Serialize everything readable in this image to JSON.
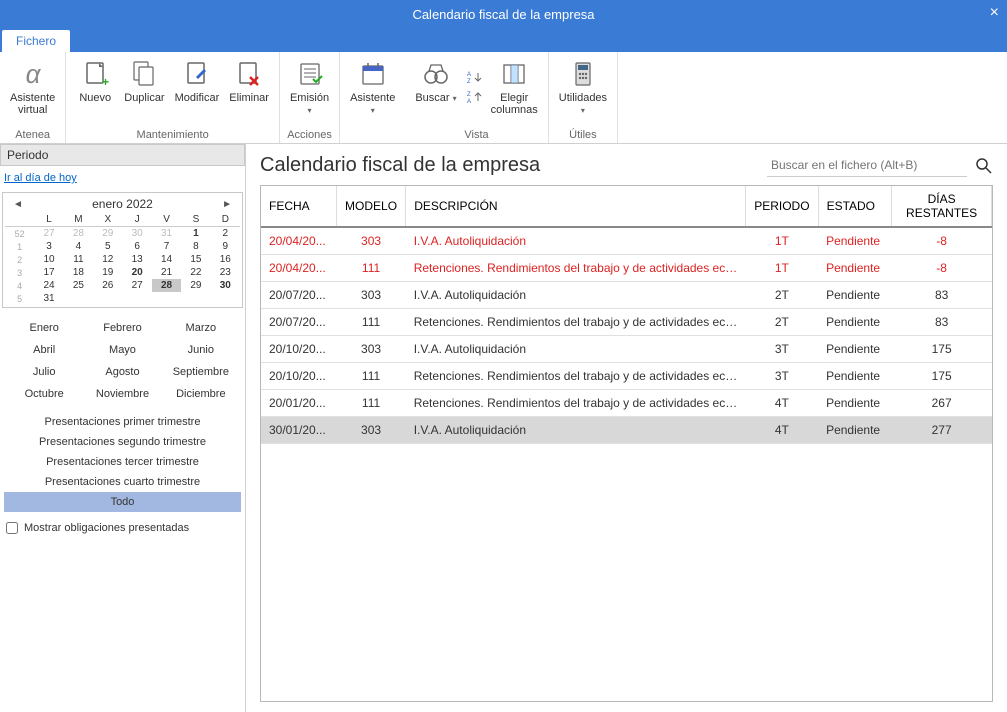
{
  "window": {
    "title": "Calendario fiscal de la empresa"
  },
  "tabs": {
    "file": "Fichero"
  },
  "ribbon": {
    "atenea": {
      "line1": "Asistente",
      "line2": "virtual",
      "group": "Atenea"
    },
    "maint": {
      "nuevo": "Nuevo",
      "duplicar": "Duplicar",
      "modificar": "Modificar",
      "eliminar": "Eliminar",
      "group": "Mantenimiento"
    },
    "acciones": {
      "emision": "Emisión",
      "group": "Acciones"
    },
    "asistente": {
      "label": "Asistente"
    },
    "vista": {
      "buscar": "Buscar",
      "cols1": "Elegir",
      "cols2": "columnas",
      "group": "Vista"
    },
    "utiles": {
      "label": "Utilidades",
      "group": "Útiles"
    }
  },
  "sidebar": {
    "period_title": "Periodo",
    "today_link": "Ir al día de hoy",
    "cal_title": "enero  2022",
    "dow": [
      "L",
      "M",
      "X",
      "J",
      "V",
      "S",
      "D"
    ],
    "weeks": [
      {
        "wk": "52",
        "days": [
          [
            "27",
            true
          ],
          [
            "28",
            true
          ],
          [
            "29",
            true
          ],
          [
            "30",
            true
          ],
          [
            "31",
            true
          ],
          [
            "1",
            false,
            "bold"
          ],
          [
            "2",
            false
          ]
        ]
      },
      {
        "wk": "1",
        "days": [
          [
            "3",
            false
          ],
          [
            "4",
            false
          ],
          [
            "5",
            false
          ],
          [
            "6",
            false
          ],
          [
            "7",
            false
          ],
          [
            "8",
            false
          ],
          [
            "9",
            false
          ]
        ]
      },
      {
        "wk": "2",
        "days": [
          [
            "10",
            false
          ],
          [
            "11",
            false
          ],
          [
            "12",
            false
          ],
          [
            "13",
            false
          ],
          [
            "14",
            false
          ],
          [
            "15",
            false
          ],
          [
            "16",
            false
          ]
        ]
      },
      {
        "wk": "3",
        "days": [
          [
            "17",
            false
          ],
          [
            "18",
            false
          ],
          [
            "19",
            false
          ],
          [
            "20",
            false,
            "bold"
          ],
          [
            "21",
            false
          ],
          [
            "22",
            false
          ],
          [
            "23",
            false
          ]
        ]
      },
      {
        "wk": "4",
        "days": [
          [
            "24",
            false
          ],
          [
            "25",
            false
          ],
          [
            "26",
            false
          ],
          [
            "27",
            false
          ],
          [
            "28",
            false,
            "today"
          ],
          [
            "29",
            false
          ],
          [
            "30",
            false,
            "bold"
          ]
        ]
      },
      {
        "wk": "5",
        "days": [
          [
            "31",
            false
          ],
          [
            "",
            false
          ],
          [
            "",
            false
          ],
          [
            "",
            false
          ],
          [
            "",
            false
          ],
          [
            "",
            false
          ],
          [
            "",
            false
          ]
        ]
      }
    ],
    "months": [
      "Enero",
      "Febrero",
      "Marzo",
      "Abril",
      "Mayo",
      "Junio",
      "Julio",
      "Agosto",
      "Septiembre",
      "Octubre",
      "Noviembre",
      "Diciembre"
    ],
    "presentations": [
      "Presentaciones primer trimestre",
      "Presentaciones segundo trimestre",
      "Presentaciones tercer trimestre",
      "Presentaciones cuarto trimestre"
    ],
    "todo": "Todo",
    "show_presented": "Mostrar obligaciones presentadas"
  },
  "main": {
    "title": "Calendario fiscal de la empresa",
    "search_placeholder": "Buscar en el fichero (Alt+B)",
    "columns": {
      "fecha": "FECHA",
      "modelo": "MODELO",
      "desc": "DESCRIPCIÓN",
      "periodo": "PERIODO",
      "estado": "ESTADO",
      "dias": "DÍAS RESTANTES"
    },
    "rows": [
      {
        "fecha": "20/04/20...",
        "modelo": "303",
        "desc": "I.V.A. Autoliquidación",
        "periodo": "1T",
        "estado": "Pendiente",
        "dias": "-8",
        "overdue": true
      },
      {
        "fecha": "20/04/20...",
        "modelo": "111",
        "desc": "Retenciones. Rendimientos del trabajo y de actividades econó...",
        "periodo": "1T",
        "estado": "Pendiente",
        "dias": "-8",
        "overdue": true
      },
      {
        "fecha": "20/07/20...",
        "modelo": "303",
        "desc": "I.V.A. Autoliquidación",
        "periodo": "2T",
        "estado": "Pendiente",
        "dias": "83"
      },
      {
        "fecha": "20/07/20...",
        "modelo": "111",
        "desc": "Retenciones. Rendimientos del trabajo y de actividades econó...",
        "periodo": "2T",
        "estado": "Pendiente",
        "dias": "83"
      },
      {
        "fecha": "20/10/20...",
        "modelo": "303",
        "desc": "I.V.A. Autoliquidación",
        "periodo": "3T",
        "estado": "Pendiente",
        "dias": "175"
      },
      {
        "fecha": "20/10/20...",
        "modelo": "111",
        "desc": "Retenciones. Rendimientos del trabajo y de actividades econó...",
        "periodo": "3T",
        "estado": "Pendiente",
        "dias": "175"
      },
      {
        "fecha": "20/01/20...",
        "modelo": "111",
        "desc": "Retenciones. Rendimientos del trabajo y de actividades econó...",
        "periodo": "4T",
        "estado": "Pendiente",
        "dias": "267"
      },
      {
        "fecha": "30/01/20...",
        "modelo": "303",
        "desc": "I.V.A. Autoliquidación",
        "periodo": "4T",
        "estado": "Pendiente",
        "dias": "277",
        "selected": true
      }
    ]
  }
}
